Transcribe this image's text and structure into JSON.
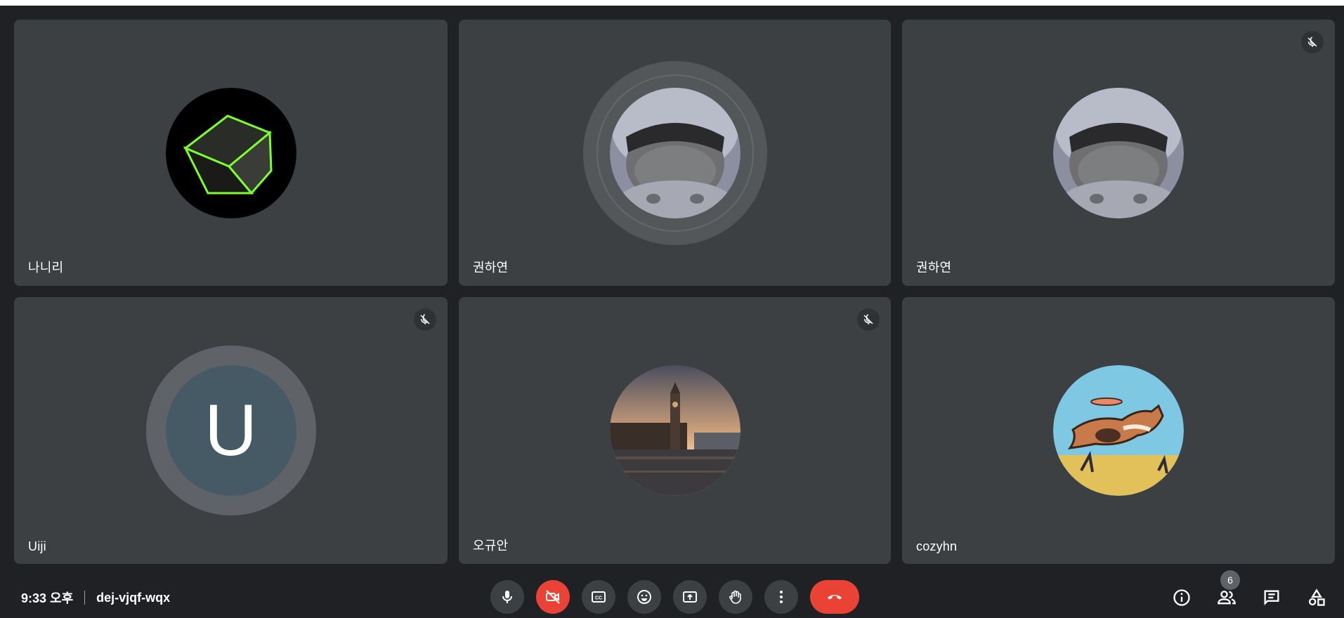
{
  "participants": [
    {
      "name": "나니리",
      "avatar": "cube-image",
      "muted": false
    },
    {
      "name": "권하연",
      "avatar": "character-image",
      "muted": false,
      "speaking": true
    },
    {
      "name": "권하연",
      "avatar": "character-image",
      "muted": true
    },
    {
      "name": "Uiji",
      "avatar_letter": "U",
      "muted": true,
      "speaking": true
    },
    {
      "name": "오규안",
      "avatar": "big-ben-image",
      "muted": true
    },
    {
      "name": "cozyhn",
      "avatar": "dog-frisbee-image",
      "muted": false
    }
  ],
  "meeting": {
    "time": "9:33 오후",
    "code": "dej-vjqf-wqx"
  },
  "controls": {
    "mic": "mic-icon",
    "camera": "camera-off-icon",
    "captions": "captions-icon",
    "reactions": "emoji-icon",
    "present": "present-icon",
    "raise_hand": "hand-icon",
    "more": "more-vert-icon",
    "leave": "call-end-icon"
  },
  "side_panel": {
    "info": "info-icon",
    "people": "people-icon",
    "people_count": "6",
    "chat": "chat-icon",
    "activities": "activities-icon"
  },
  "colors": {
    "background": "#202124",
    "tile": "#3c4043",
    "danger": "#ea4335",
    "letter_avatar": "#455a64"
  }
}
